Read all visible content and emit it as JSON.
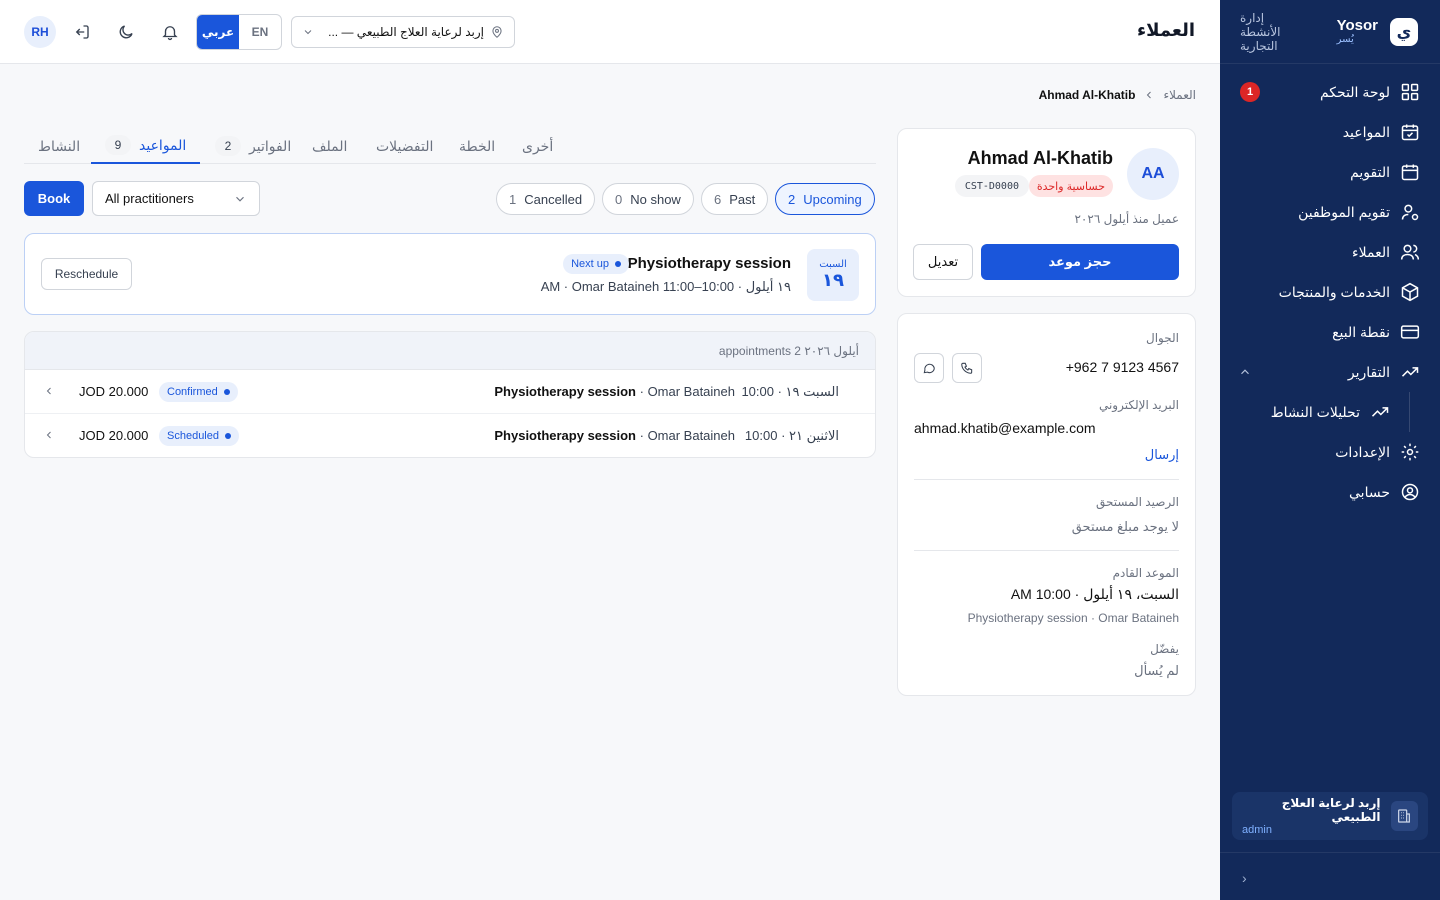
{
  "app": {
    "brand": "Yosor",
    "brand_sub": "يُسر",
    "brand_tagline": "إدارة الأنشطة التجارية",
    "logo_letter": "ي"
  },
  "sidebar": {
    "items": [
      {
        "label": "لوحة التحكم",
        "icon": "dashboard-icon",
        "badge": "1"
      },
      {
        "label": "المواعيد",
        "icon": "calendar-check-icon"
      },
      {
        "label": "التقويم",
        "icon": "calendar-icon"
      },
      {
        "label": "تقويم الموظفين",
        "icon": "user-cog-icon"
      },
      {
        "label": "العملاء",
        "icon": "users-icon"
      },
      {
        "label": "الخدمات والمنتجات",
        "icon": "box-icon"
      },
      {
        "label": "نقطة البيع",
        "icon": "credit-card-icon"
      },
      {
        "label": "التقارير",
        "icon": "trending-up-icon"
      },
      {
        "label": "الإعدادات",
        "icon": "settings-icon"
      },
      {
        "label": "حسابي",
        "icon": "user-circle-icon"
      }
    ],
    "sub_item": "تحليلات النشاط",
    "org": {
      "name": "إربد لرعاية العلاج الطبيعي",
      "role": "admin"
    },
    "collapse": "›"
  },
  "header": {
    "title": "العملاء",
    "avatar": "RH",
    "lang_en": "EN",
    "lang_ar": "عربي",
    "location": "إربد لرعاية العلاج الطبيعي — ..."
  },
  "breadcrumb": {
    "parent": "العملاء",
    "current": "Ahmad Al-Khatib"
  },
  "customer": {
    "initials": "AA",
    "name": "Ahmad Al-Khatib",
    "allergy_tag": "حساسية واحدة",
    "code": "CST-D0000",
    "since": "عميل منذ أيلول ٢٠٢٦",
    "book_label": "حجز موعد",
    "edit_label": "تعديل"
  },
  "info": {
    "mobile_label": "الجوال",
    "mobile": "+962 7 9123 4567",
    "email_label": "البريد الإلكتروني",
    "email": "ahmad.khatib@example.com",
    "send_label": "إرسال",
    "balance_label": "الرصيد المستحق",
    "balance_value": "لا يوجد مبلغ مستحق",
    "next_label": "الموعد القادم",
    "next_date": "السبت، ١٩ أيلول · 10:00 AM",
    "next_service": "Physiotherapy session · Omar Bataineh",
    "prefers_label": "يفضّل",
    "prefers_value": "لم يُسأل"
  },
  "tabs": [
    {
      "label": "النشاط"
    },
    {
      "label": "المواعيد",
      "count": "9",
      "active": true
    },
    {
      "label": "الفواتير",
      "count": "2"
    },
    {
      "label": "الملف"
    },
    {
      "label": "التفضيلات"
    },
    {
      "label": "الخطة"
    },
    {
      "label": "أخرى"
    }
  ],
  "filters": {
    "book_label": "Book",
    "practitioner": "All practitioners",
    "pills": [
      {
        "count": "2",
        "label": "Upcoming",
        "active": true
      },
      {
        "count": "6",
        "label": "Past"
      },
      {
        "count": "0",
        "label": "No show"
      },
      {
        "count": "1",
        "label": "Cancelled"
      }
    ]
  },
  "next_up": {
    "day_name": "السبت",
    "day_num": "١٩",
    "title": "Physiotherapy session",
    "badge": "Next up",
    "subtitle": "١٩ أيلول · 10:00–11:00 AM · Omar Bataineh",
    "reschedule": "Reschedule"
  },
  "appointments": {
    "group_header": "أيلول ٢٠٢٦ appointments 2",
    "rows": [
      {
        "date": "السبت ١٩ · 10:00",
        "service": "Physiotherapy session",
        "practitioner": "Omar Bataineh",
        "status": "Confirmed",
        "price": "JOD 20.000"
      },
      {
        "date": "الاثنين ٢١ · 10:00",
        "service": "Physiotherapy session",
        "practitioner": "Omar Bataineh",
        "status": "Scheduled",
        "price": "JOD 20.000"
      }
    ]
  },
  "colors": {
    "primary": "#1a56db",
    "sidebar": "#12295a",
    "danger": "#dc2626"
  }
}
